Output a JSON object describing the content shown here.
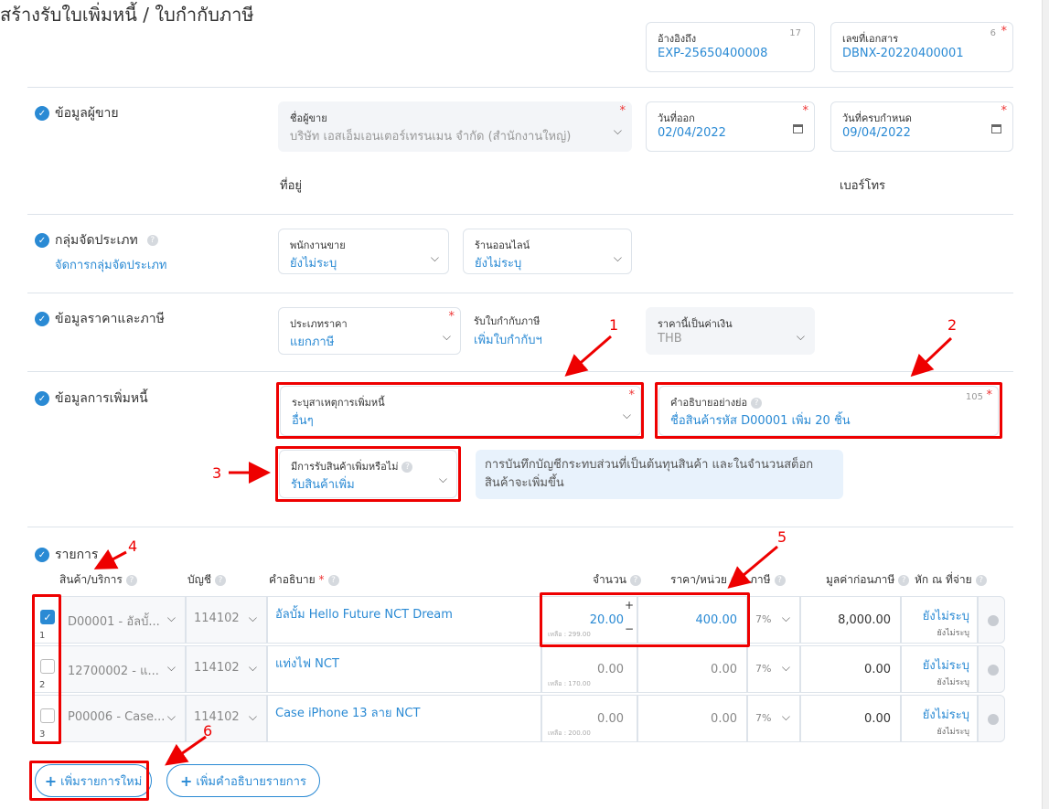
{
  "page_title": "สร้างรับใบเพิ่มหนี้ / ใบกำกับภาษี",
  "header_fields": [
    {
      "label": "อ้างอิงถึง",
      "value": "EXP-25650400008",
      "count": "17"
    },
    {
      "label": "เลขที่เอกสาร",
      "value": "DBNX-20220400001",
      "count": "6"
    }
  ],
  "seller": {
    "section": "ข้อมูลผู้ขาย",
    "name_label": "ชื่อผู้ขาย",
    "name_value": "บริษัท เอสเอ็มเอนเตอร์เทรนเมน จำกัด (สำนักงานใหญ่)",
    "issue_label": "วันที่ออก",
    "issue_value": "02/04/2022",
    "due_label": "วันที่ครบกำหนด",
    "due_value": "09/04/2022",
    "address_label": "ที่อยู่",
    "phone_label": "เบอร์โทร"
  },
  "classify": {
    "section": "กลุ่มจัดประเภท",
    "manage_link": "จัดการกลุ่มจัดประเภท",
    "sales_label": "พนักงานขาย",
    "sales_value": "ยังไม่ระบุ",
    "shop_label": "ร้านออนไลน์",
    "shop_value": "ยังไม่ระบุ"
  },
  "pricing": {
    "section": "ข้อมูลราคาและภาษี",
    "price_type_label": "ประเภทราคา",
    "price_type_value": "แยกภาษี",
    "tax_inv_label": "รับใบกำกับภาษี",
    "tax_inv_link": "เพิ่มใบกำกับฯ",
    "currency_label": "ราคานี้เป็นค่าเงิน",
    "currency_value": "THB"
  },
  "debit": {
    "section": "ข้อมูลการเพิ่มหนี้",
    "reason_label": "ระบุสาเหตุการเพิ่มหนี้",
    "reason_value": "อื่นๆ",
    "desc_label": "คำอธิบายอย่างย่อ",
    "desc_value": "ชื่อสินค้ารหัส D00001 เพิ่ม 20 ชิ้น",
    "desc_count": "105",
    "receive_label": "มีการรับสินค้าเพิ่มหรือไม่",
    "receive_value": "รับสินค้าเพิ่ม",
    "info_note": "การบันทึกบัญชีกระทบส่วนที่เป็นต้นทุนสินค้า และในจำนวนสต็อกสินค้าจะเพิ่มขึ้น"
  },
  "items": {
    "section": "รายการ",
    "headers": {
      "product": "สินค้า/บริการ",
      "account": "บัญชี",
      "desc": "คำอธิบาย",
      "qty": "จำนวน",
      "price": "ราคา/หน่วย",
      "tax": "ภาษี",
      "pretax": "มูลค่าก่อนภาษี",
      "wht": "หัก ณ ที่จ่าย"
    },
    "rows": [
      {
        "idx": "1",
        "product": "D00001 - อัลบั้...",
        "account": "114102",
        "desc": "อัลบั้ม Hello Future NCT Dream",
        "qty": "20.00",
        "remain": "เหลือ : 299.00",
        "price": "400.00",
        "tax": "7%",
        "pretax": "8,000.00",
        "wht": "ยังไม่ระบุ",
        "wht_sub": "ยังไม่ระบุ"
      },
      {
        "idx": "2",
        "product": "12700002 - แ...",
        "account": "114102",
        "desc": "แท่งไฟ NCT",
        "qty": "0.00",
        "remain": "เหลือ : 170.00",
        "price": "0.00",
        "tax": "7%",
        "pretax": "0.00",
        "wht": "ยังไม่ระบุ",
        "wht_sub": "ยังไม่ระบุ"
      },
      {
        "idx": "3",
        "product": "P00006 - Case...",
        "account": "114102",
        "desc": "Case iPhone 13 ลาย NCT",
        "qty": "0.00",
        "remain": "เหลือ : 200.00",
        "price": "0.00",
        "tax": "7%",
        "pretax": "0.00",
        "wht": "ยังไม่ระบุ",
        "wht_sub": "ยังไม่ระบุ"
      }
    ]
  },
  "buttons": {
    "add_item": "เพิ่มรายการใหม่",
    "add_desc": "เพิ่มคำอธิบายรายการ"
  },
  "annotations": [
    "1",
    "2",
    "3",
    "4",
    "5",
    "6"
  ],
  "colors": {
    "accent": "#2a8ad4",
    "annotation": "#e00000"
  }
}
